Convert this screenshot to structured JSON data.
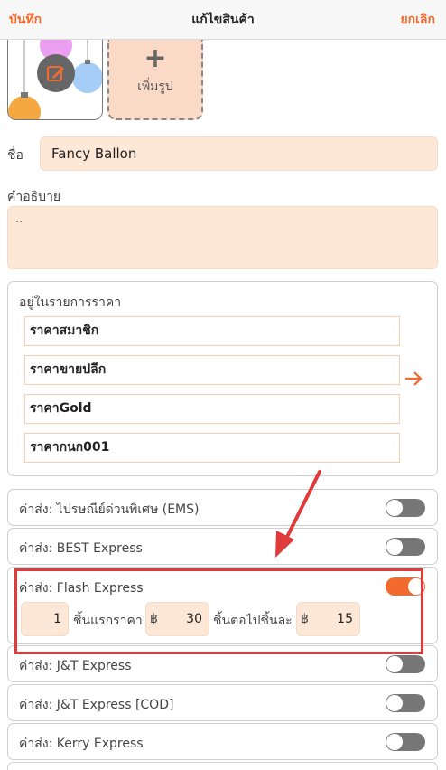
{
  "header": {
    "save_label": "บันทึก",
    "title": "แก้ไขสินค้า",
    "cancel_label": "ยกเลิก"
  },
  "photos": {
    "add_label": "เพิ่มรูป",
    "add_plus": "+"
  },
  "name": {
    "label": "ชื่อ",
    "value": "Fancy Ballon"
  },
  "description": {
    "label": "คำอธิบาย",
    "value": ".."
  },
  "price_lists": {
    "label": "อยู่ในรายการราคา",
    "items": [
      "ราคาสมาชิก",
      "ราคาขายปลีก",
      "ราคาGold",
      "ราคากนก001"
    ]
  },
  "shipping": [
    {
      "label": "ค่าส่ง: ไปรษณีย์ด่วนพิเศษ (EMS)",
      "enabled": false
    },
    {
      "label": "ค่าส่ง: BEST Express",
      "enabled": false
    },
    {
      "label": "ค่าส่ง: Flash Express",
      "enabled": true
    },
    {
      "label": "ค่าส่ง: J&T Express",
      "enabled": false
    },
    {
      "label": "ค่าส่ง: J&T Express [COD]",
      "enabled": false
    },
    {
      "label": "ค่าส่ง: Kerry Express",
      "enabled": false
    }
  ],
  "flash_fee": {
    "first_qty": "1",
    "first_text": "ชิ้นแรกราคา",
    "currency": "฿",
    "first_price": "30",
    "next_text": "ชิ้นต่อไปชิ้นละ",
    "next_price": "15"
  },
  "colors": {
    "accent": "#f26a2e",
    "field_bg": "#fde7d6",
    "annotation": "#e03a3a"
  }
}
